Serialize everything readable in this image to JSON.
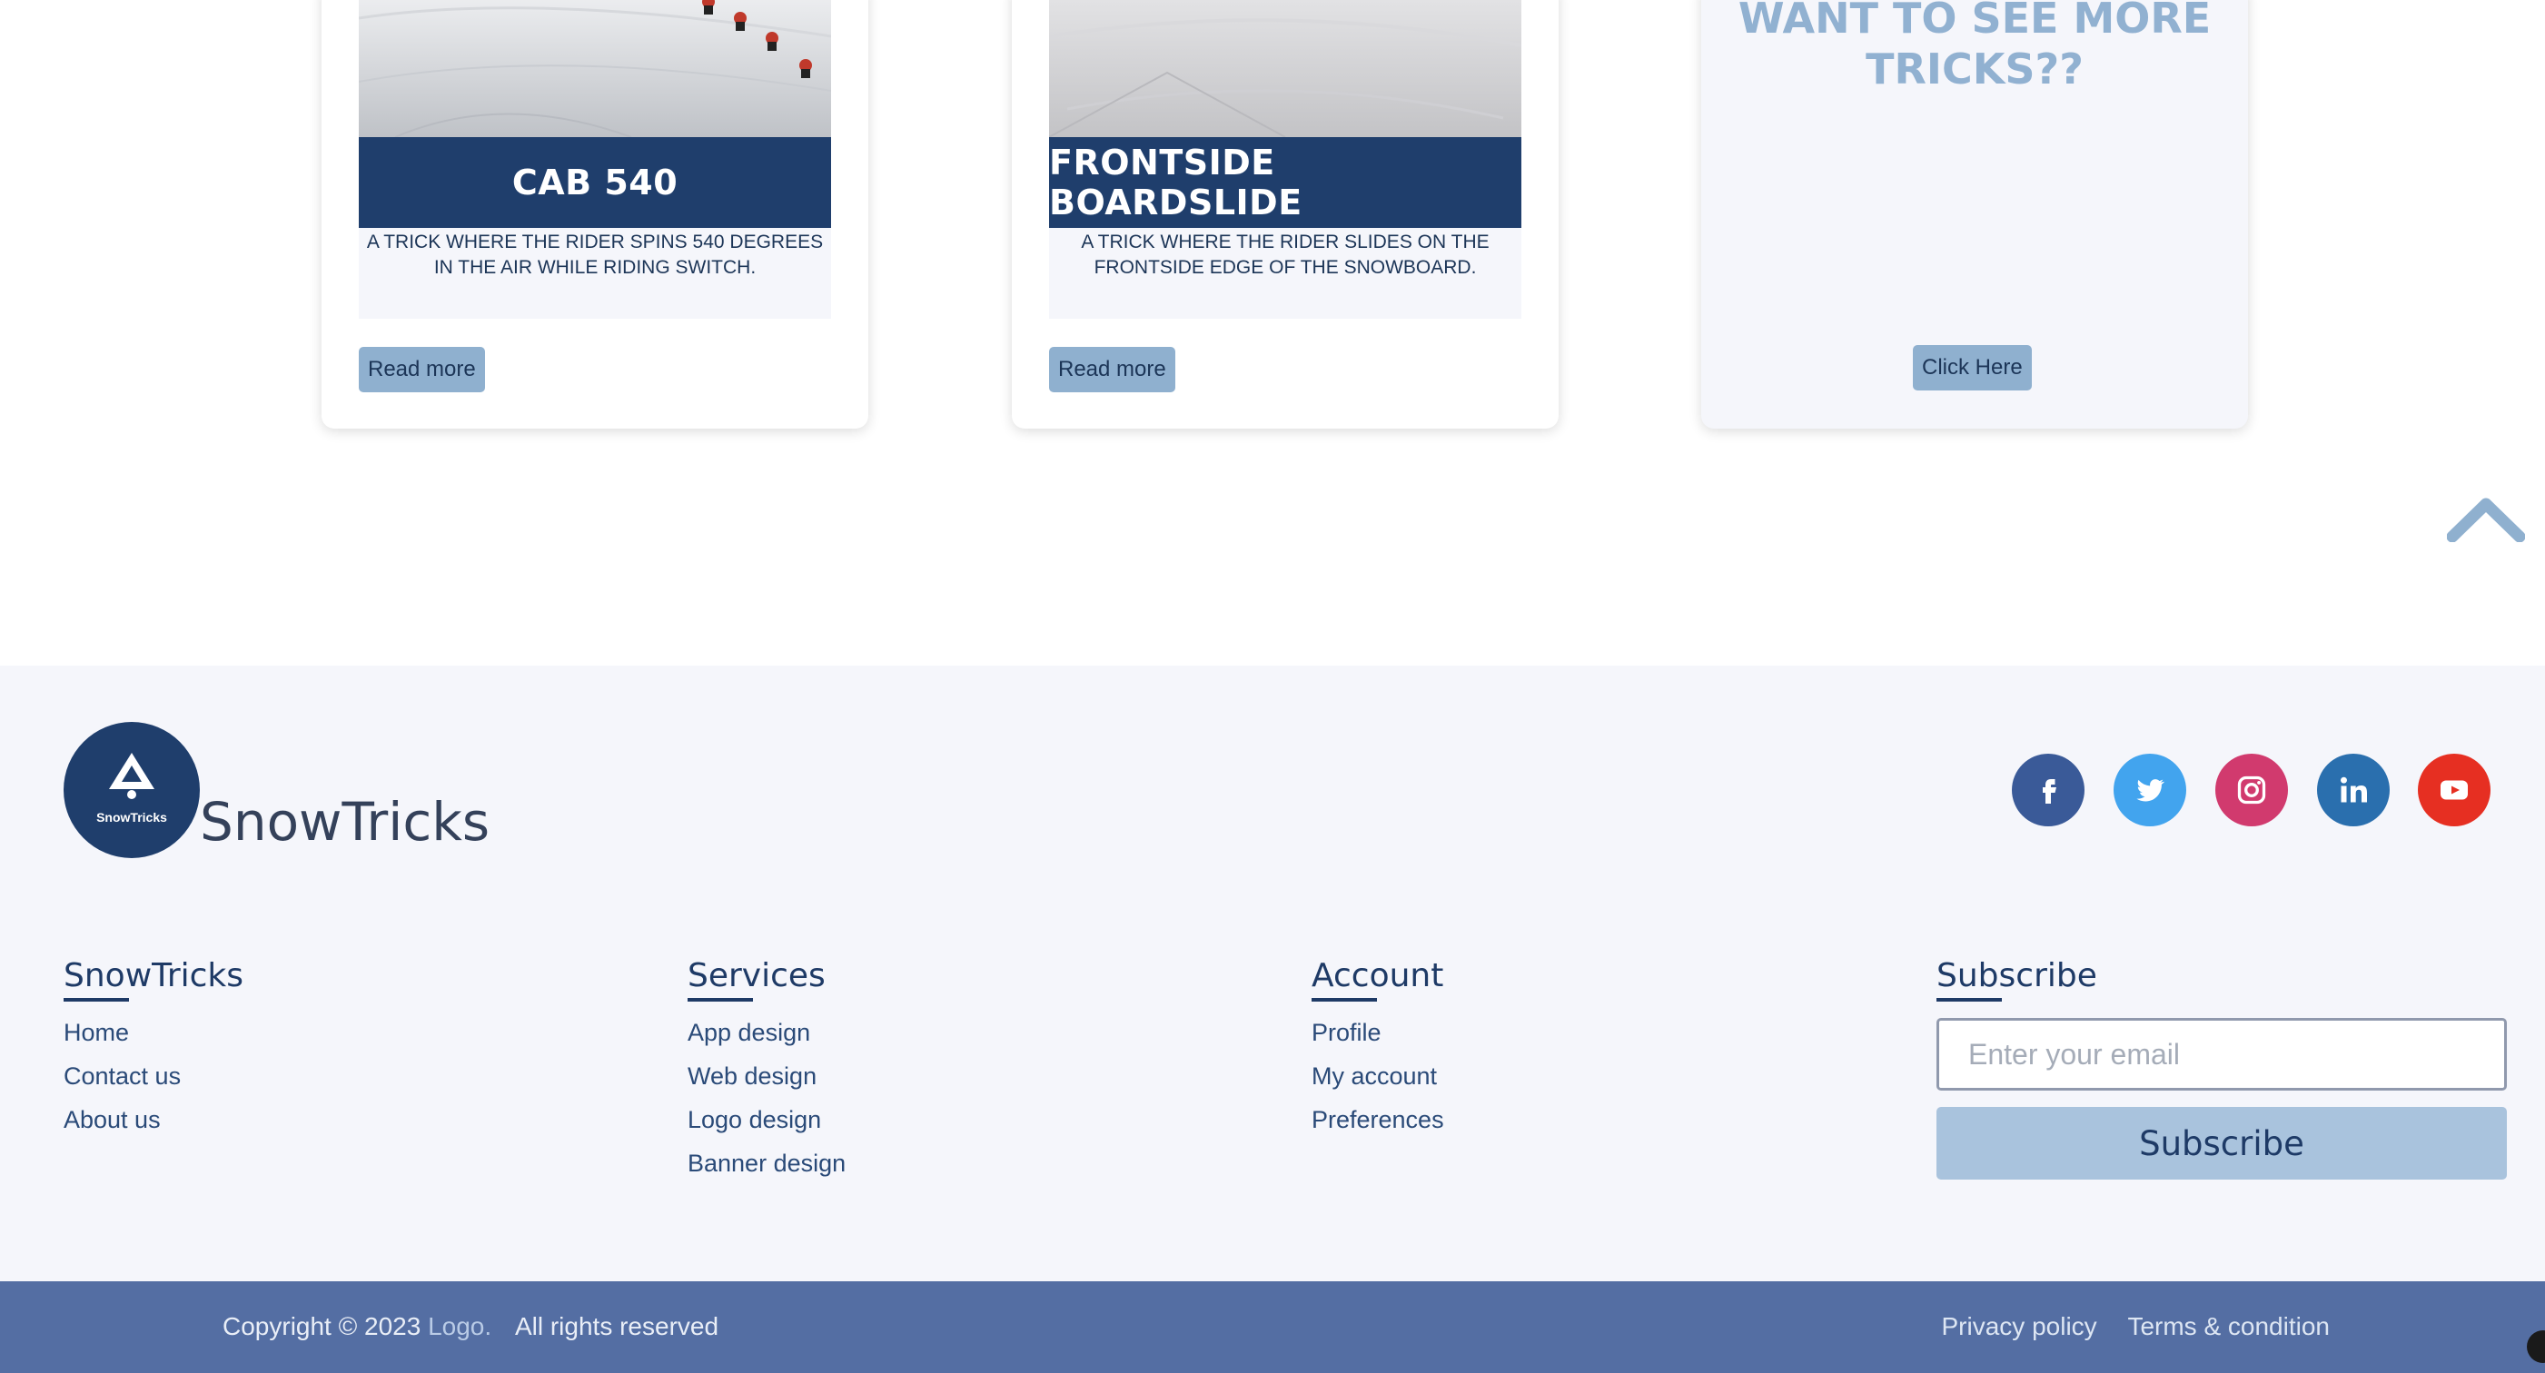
{
  "cards": [
    {
      "title": "CAB 540",
      "description": "A TRICK WHERE THE RIDER SPINS 540 DEGREES IN THE AIR WHILE RIDING SWITCH.",
      "button_label": "Read more"
    },
    {
      "title": "FRONTSIDE BOARDSLIDE",
      "description": "A TRICK WHERE THE RIDER SLIDES ON THE FRONTSIDE EDGE OF THE SNOWBOARD.",
      "button_label": "Read more"
    }
  ],
  "more_card": {
    "title": "WANT TO SEE MORE TRICKS??",
    "button_label": "Click Here"
  },
  "scroll_top": {
    "icon": "chevron-up-icon"
  },
  "footer": {
    "logo_text": "SnowTricks",
    "brand_name": "SnowTricks",
    "social": [
      {
        "name": "facebook-icon",
        "color": "#3a5a98"
      },
      {
        "name": "twitter-icon",
        "color": "#42a4ee"
      },
      {
        "name": "instagram-icon",
        "color": "#d13a6e"
      },
      {
        "name": "linkedin-icon",
        "color": "#2a6fae"
      },
      {
        "name": "youtube-icon",
        "color": "#e62f22"
      }
    ],
    "columns": {
      "snowtricks": {
        "heading": "SnowTricks",
        "links": [
          "Home",
          "Contact us",
          "About us"
        ]
      },
      "services": {
        "heading": "Services",
        "links": [
          "App design",
          "Web design",
          "Logo design",
          "Banner design"
        ]
      },
      "account": {
        "heading": "Account",
        "links": [
          "Profile",
          "My account",
          "Preferences"
        ]
      },
      "subscribe": {
        "heading": "Subscribe",
        "email_placeholder": "Enter your email",
        "button_label": "Subscribe"
      }
    }
  },
  "bottom_bar": {
    "copyright_prefix": "Copyright © 2023",
    "logo_link": "Logo.",
    "rights": "All rights reserved",
    "privacy": "Privacy policy",
    "terms": "Terms & condition"
  },
  "colors": {
    "primary_dark": "#1f3e6c",
    "accent_light": "#8fb0cf",
    "footer_bg": "#f5f6fb",
    "bottom_bar": "#546ea3"
  }
}
